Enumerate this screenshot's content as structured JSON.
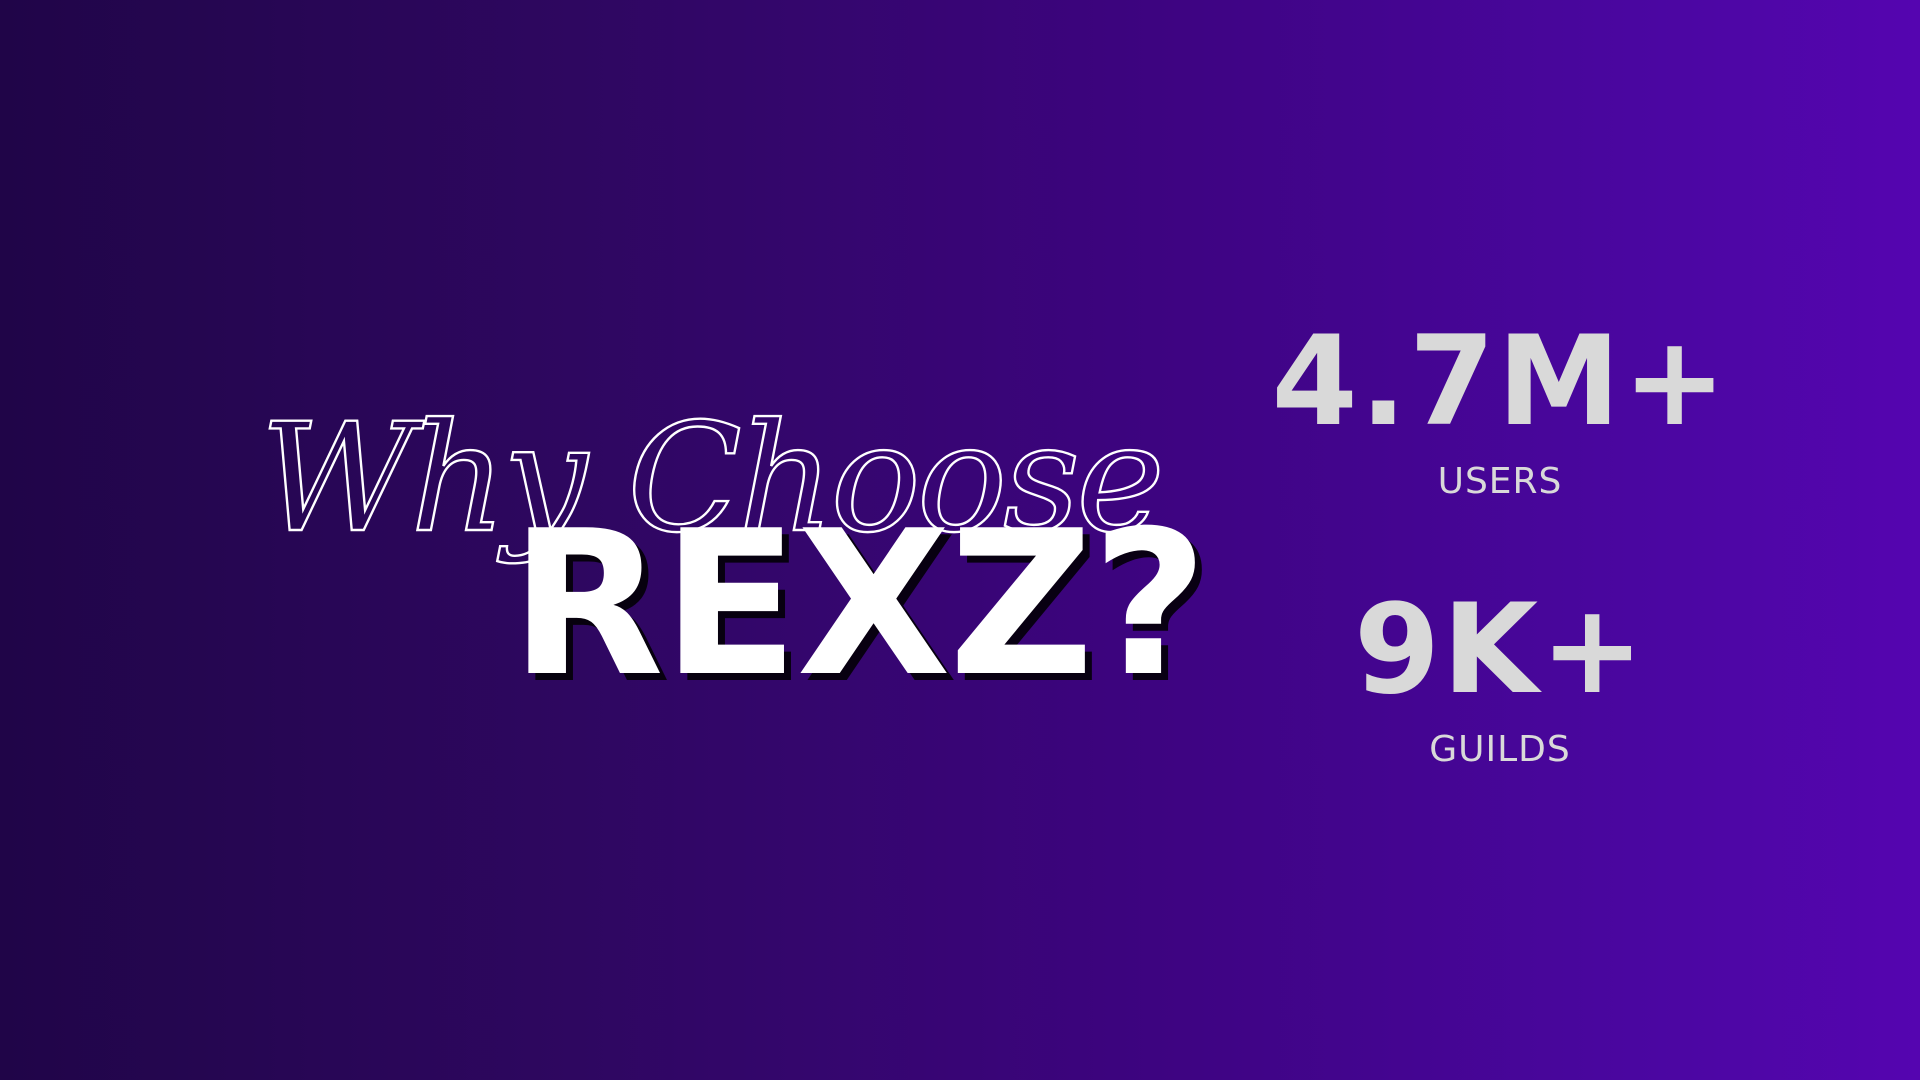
{
  "hero": {
    "script_title": "Why Choose",
    "brand": "REXZ?"
  },
  "stats": [
    {
      "value": "4.7M+",
      "label": "USERS"
    },
    {
      "value": "9K+",
      "label": "GUILDS"
    }
  ],
  "colors": {
    "background_start": "#200548",
    "background_end": "#5505b0",
    "text_primary": "#ffffff",
    "stat_text": "#d9d9d9"
  }
}
